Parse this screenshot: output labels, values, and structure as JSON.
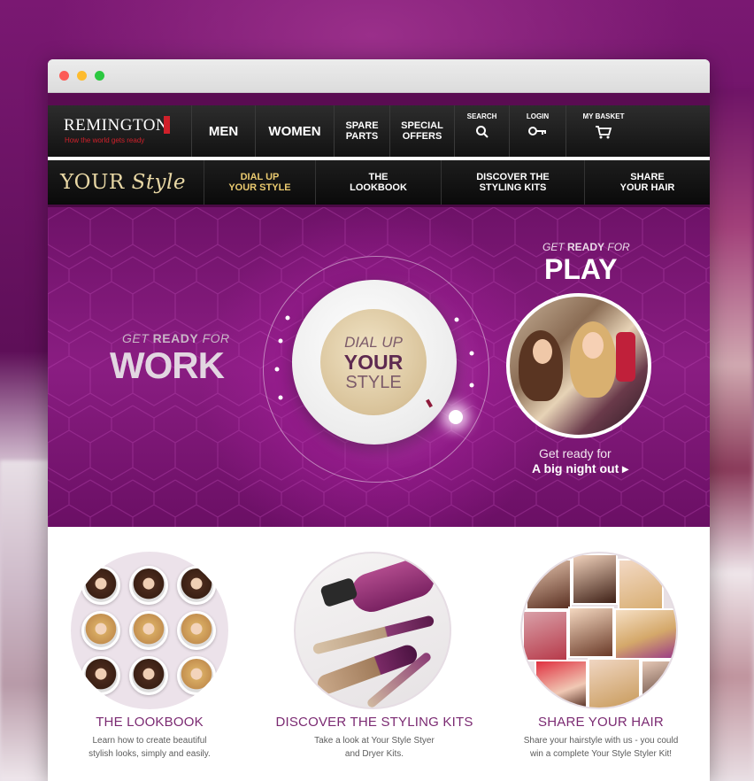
{
  "browser": {
    "buttons": [
      "close",
      "minimize",
      "maximize"
    ]
  },
  "brand": {
    "name": "REMINGTON",
    "tagline": "How the world gets ready"
  },
  "topnav": {
    "items": [
      {
        "label": "MEN"
      },
      {
        "label": "WOMEN"
      },
      {
        "label": "SPARE\nPARTS"
      },
      {
        "label": "SPECIAL\nOFFERS"
      }
    ],
    "utilities": [
      {
        "label": "SEARCH",
        "icon": "search-icon"
      },
      {
        "label": "LOGIN",
        "icon": "key-icon"
      },
      {
        "label": "MY BASKET",
        "icon": "cart-icon"
      }
    ]
  },
  "subnav": {
    "brand_pre": "YOUR ",
    "brand_script": "Style",
    "items": [
      {
        "label": "DIAL UP\nYOUR STYLE",
        "active": true
      },
      {
        "label": "THE\nLOOKBOOK",
        "active": false
      },
      {
        "label": "DISCOVER THE\nSTYLING KITS",
        "active": false
      },
      {
        "label": "SHARE\nYOUR HAIR",
        "active": false
      }
    ]
  },
  "hero": {
    "work_pre_a": "GET ",
    "work_pre_b": "READY",
    "work_pre_c": " FOR",
    "work": "WORK",
    "play_pre_a": "GET ",
    "play_pre_b": "READY",
    "play_pre_c": " FOR",
    "play": "PLAY",
    "dial_line1": "DIAL UP",
    "dial_line2": "YOUR",
    "dial_line3": "STYLE",
    "night_line1": "Get ready for",
    "night_line2": "A big night out ▸"
  },
  "features": [
    {
      "title": "THE LOOKBOOK",
      "desc": "Learn how to create beautiful\nstylish looks, simply and easily."
    },
    {
      "title": "DISCOVER THE STYLING KITS",
      "desc": "Take a look at Your Style Styer\nand Dryer Kits."
    },
    {
      "title": "SHARE YOUR HAIR",
      "desc": "Share your hairstyle with us - you could\nwin a complete Your Style Styler Kit!"
    }
  ],
  "colors": {
    "brand_red": "#d0202a",
    "accent_purple": "#7b2a72",
    "active_gold": "#e9c96f",
    "nav_dark": "#151515"
  }
}
